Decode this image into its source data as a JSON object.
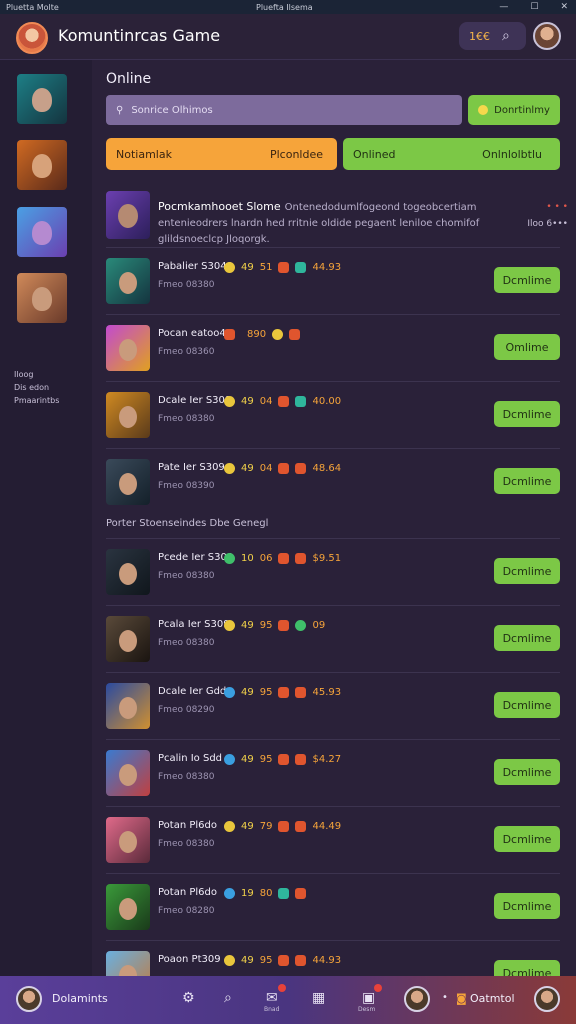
{
  "titlebar": {
    "left": "Pluetta Molte",
    "center": "Pluefta Ilsema",
    "min": "—",
    "max": "☐",
    "close": "✕"
  },
  "header": {
    "title": "Komuntinrcas Game",
    "pill_value": "1€€",
    "search_icon": "search-icon",
    "accent": "#f3b34a"
  },
  "sidebar": {
    "caption": "Iloog\nDis edon\nPmaarintbs"
  },
  "main": {
    "section_title": "Online",
    "search": {
      "placeholder": "Sonrice Olhimos",
      "button_label": "Donrtinlmy"
    },
    "tabs": [
      {
        "left": "Notiamlak",
        "right": "Plconldee"
      },
      {
        "left": "Onlined",
        "right": "Onlnlolbtlu"
      }
    ],
    "feature": {
      "title": "Pocmkamhooet Slome",
      "desc": "Ontenedodumlfogeond togeobcertiam entenieodrers lnardn hed rritnie oldide pegaent leniloe chomifof glildsnoeclcp Jloqorgk.",
      "meta_top": "• • •",
      "meta_bottom": "Iloo 6•••"
    },
    "group_label": "Porter Stoenseindes Dbe Genegl",
    "action_label": "Dcmlime",
    "rows": [
      {
        "name": "Pabalier S3049",
        "sub": "Fmeo 08380",
        "s1": "49",
        "s2": "51",
        "s3": "44.93",
        "btn": "Dcmlime"
      },
      {
        "name": "Pocan eatoo49",
        "sub": "Fmeo 08360",
        "s1": "",
        "s2": "890",
        "s3": "",
        "btn": "Omlime"
      },
      {
        "name": "Dcale Ier S309",
        "sub": "Fmeo 08380",
        "s1": "49",
        "s2": "04",
        "s3": "40.00",
        "btn": "Dcmlime"
      },
      {
        "name": "Pate Ier S309",
        "sub": "Fmeo 08390",
        "s1": "49",
        "s2": "04",
        "s3": "48.64",
        "btn": "Dcmlime"
      },
      {
        "name": "Pcede Ier S309",
        "sub": "Fmeo 08380",
        "s1": "10",
        "s2": "06",
        "s3": "$9.51",
        "btn": "Dcmlime"
      },
      {
        "name": "Pcala Ier S309",
        "sub": "Fmeo 08380",
        "s1": "49",
        "s2": "95",
        "s3": "09",
        "btn": "Dcmlime"
      },
      {
        "name": "Dcale Ier Gdd",
        "sub": "Fmeo 08290",
        "s1": "49",
        "s2": "95",
        "s3": "45.93",
        "btn": "Dcmlime"
      },
      {
        "name": "Pcalin Io Sdd",
        "sub": "Fmeo 08380",
        "s1": "49",
        "s2": "95",
        "s3": "$4.27",
        "btn": "Dcmlime"
      },
      {
        "name": "Potan Pl6do",
        "sub": "Fmeo 08380",
        "s1": "49",
        "s2": "79",
        "s3": "44.49",
        "btn": "Dcmlime"
      },
      {
        "name": "Potan Pl6do",
        "sub": "Fmeo 08280",
        "s1": "19",
        "s2": "80",
        "s3": "",
        "btn": "Dcmlime"
      },
      {
        "name": "Poaon Pt309",
        "sub": "",
        "s1": "49",
        "s2": "95",
        "s3": "44.93",
        "btn": "Dcmlime"
      }
    ]
  },
  "bottom": {
    "label_left": "Dolamints",
    "label_right": "Oatmtol",
    "tiny1": "Bnad",
    "tiny2": "Desm"
  },
  "colors": {
    "green": "#7cc846",
    "orange": "#f6a43a",
    "bg": "#2a2139"
  }
}
